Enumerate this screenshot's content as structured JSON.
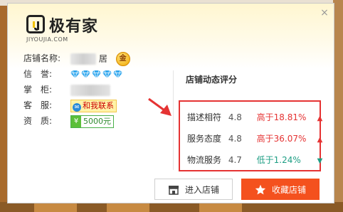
{
  "logo": {
    "name": "极有家",
    "domain": "JIYOUJIA.COM"
  },
  "shop": {
    "name_label": "店铺名称:",
    "name_suffix": "居",
    "gold_badge": "金",
    "reputation_label": "信　誉:",
    "reputation_diamonds": 5,
    "keeper_label": "掌　柜:",
    "service_label": "客　服:",
    "contact_label": "和我联系",
    "deposit_label": "资　质:",
    "deposit_value": "5000元"
  },
  "ratings": {
    "title": "店铺动态评分",
    "items": [
      {
        "name": "描述相符",
        "score": "4.8",
        "compare": "高于18.81%",
        "direction": "up"
      },
      {
        "name": "服务态度",
        "score": "4.8",
        "compare": "高于36.07%",
        "direction": "up"
      },
      {
        "name": "物流服务",
        "score": "4.7",
        "compare": "低于1.24%",
        "direction": "down"
      }
    ]
  },
  "buttons": {
    "enter_shop": "进入店铺",
    "favorite_shop": "收藏店铺"
  },
  "colors": {
    "up": "#e53333",
    "down": "#1e9e84",
    "accent": "#f4511e",
    "highlight_box": "#e53333"
  },
  "icons": {
    "close": "close-icon",
    "shop": "shop-icon",
    "star": "star-icon",
    "pointer": "red-arrow-icon"
  }
}
